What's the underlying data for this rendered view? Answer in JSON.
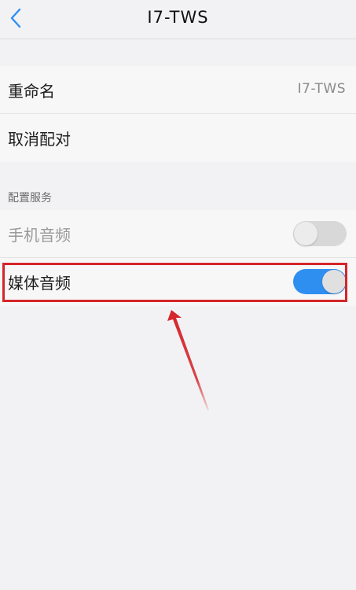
{
  "header": {
    "title": "I7-TWS",
    "back_icon": "chevron-left-icon"
  },
  "device_settings": {
    "rename_label": "重命名",
    "rename_value": "I7-TWS",
    "unpair_label": "取消配对"
  },
  "services": {
    "header": "配置服务",
    "items": [
      {
        "label": "手机音频",
        "enabled": false
      },
      {
        "label": "媒体音频",
        "enabled": true
      }
    ]
  },
  "colors": {
    "accent": "#2f8ff1",
    "highlight": "#d4262a"
  }
}
